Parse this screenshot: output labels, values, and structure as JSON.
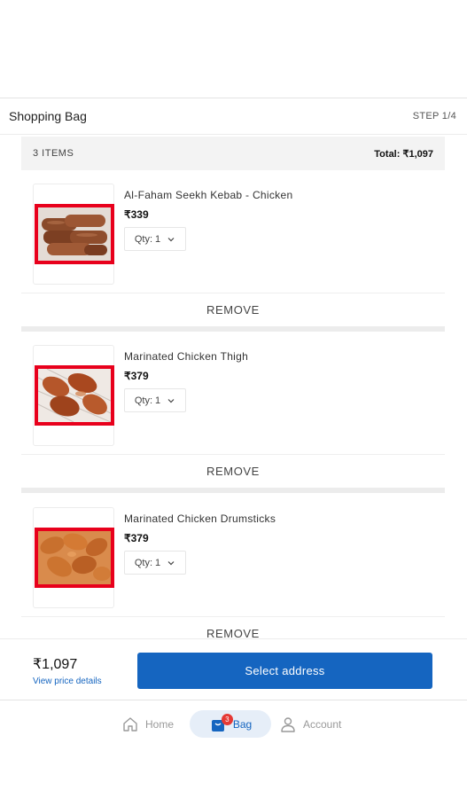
{
  "header": {
    "title": "Shopping Bag",
    "step": "STEP 1/4"
  },
  "summary": {
    "count_label": "3 ITEMS",
    "total_label": "Total: ₹1,097"
  },
  "items": [
    {
      "name": "Al-Faham Seekh Kebab - Chicken",
      "price": "₹339",
      "qty_label": "Qty: 1",
      "remove_label": "REMOVE"
    },
    {
      "name": "Marinated Chicken Thigh",
      "price": "₹379",
      "qty_label": "Qty: 1",
      "remove_label": "REMOVE"
    },
    {
      "name": "Marinated Chicken Drumsticks",
      "price": "₹379",
      "qty_label": "Qty: 1",
      "remove_label": "REMOVE"
    }
  ],
  "checkout": {
    "amount": "₹1,097",
    "details_link": "View price details",
    "button_label": "Select address"
  },
  "nav": {
    "home": "Home",
    "bag": "Bag",
    "bag_badge": "3",
    "account": "Account"
  },
  "colors": {
    "accent": "#1565c0",
    "image_frame": "#e8001c",
    "badge": "#e53935"
  }
}
